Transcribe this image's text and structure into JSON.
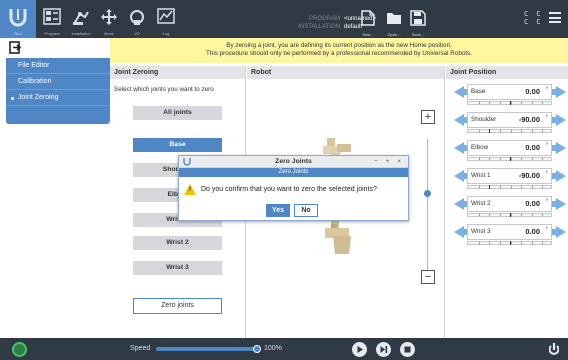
{
  "topbar": {
    "nav": [
      {
        "label": "Run",
        "icon": "universal-robots-logo-icon",
        "active": true
      },
      {
        "label": "Program",
        "icon": "program-icon"
      },
      {
        "label": "Installation",
        "icon": "installation-icon"
      },
      {
        "label": "Move",
        "icon": "move-arrows-icon"
      },
      {
        "label": "I/O",
        "icon": "io-icon"
      },
      {
        "label": "Log",
        "icon": "log-chart-icon"
      }
    ],
    "program_label": "PROGRAM",
    "program_value": "<unnamed>",
    "installation_label": "INSTALLATION",
    "installation_value": "default",
    "file_buttons": [
      {
        "label": "New...",
        "icon": "new-file-icon"
      },
      {
        "label": "Open...",
        "icon": "open-folder-icon"
      },
      {
        "label": "Save...",
        "icon": "save-icon"
      }
    ],
    "status_glyphs": [
      "C  C",
      "C  C"
    ]
  },
  "sidebar": {
    "items": [
      {
        "label": "File Editor"
      },
      {
        "label": "Calibration"
      },
      {
        "label": "Joint Zeroing",
        "active": true
      }
    ]
  },
  "banner": {
    "line1": "By zeroing a joint, you are defining its current position as the new Home position.",
    "line2": "This procedure should only be performed by a professional recommended by Universal Robots."
  },
  "joint_zeroing": {
    "header": "Joint Zeroing",
    "prompt": "Select which joints you want to zero",
    "buttons": [
      {
        "label": "All joints",
        "selected": false
      },
      {
        "label": "Base",
        "selected": true
      },
      {
        "label": "Shoulder",
        "selected": false
      },
      {
        "label": "Elbow",
        "selected": false
      },
      {
        "label": "Wrist 1",
        "selected": false
      },
      {
        "label": "Wrist 2",
        "selected": false
      },
      {
        "label": "Wrist 3",
        "selected": false
      }
    ],
    "zero_button": "Zero joints"
  },
  "robot": {
    "header": "Robot",
    "zoom_in": "+",
    "zoom_out": "−"
  },
  "joint_position": {
    "header": "Joint Position",
    "unit": "°",
    "rows": [
      {
        "name": "Base",
        "value": "0.00",
        "fraction": 0.5
      },
      {
        "name": "Shoulder",
        "value": "-90.00",
        "fraction": 0.25
      },
      {
        "name": "Elbow",
        "value": "0.00",
        "fraction": 0.5
      },
      {
        "name": "Wrist 1",
        "value": "-90.00",
        "fraction": 0.25
      },
      {
        "name": "Wrist 2",
        "value": "0.00",
        "fraction": 0.5
      },
      {
        "name": "Wrist 3",
        "value": "0.00",
        "fraction": 0.5
      }
    ]
  },
  "dialog": {
    "title": "Zero Joints",
    "window_buttons": "− + ×",
    "header": "Zero Joints",
    "message": "Do you confirm that you want to zero the selected joints?",
    "yes": "Yes",
    "no": "No"
  },
  "footer": {
    "speed_label": "Speed",
    "speed_value": "100%",
    "speed_fraction": 1.0
  },
  "colors": {
    "accent": "#4f86c6",
    "topbar": "#303a45",
    "banner": "#fff79f",
    "power": "#43c66a"
  }
}
